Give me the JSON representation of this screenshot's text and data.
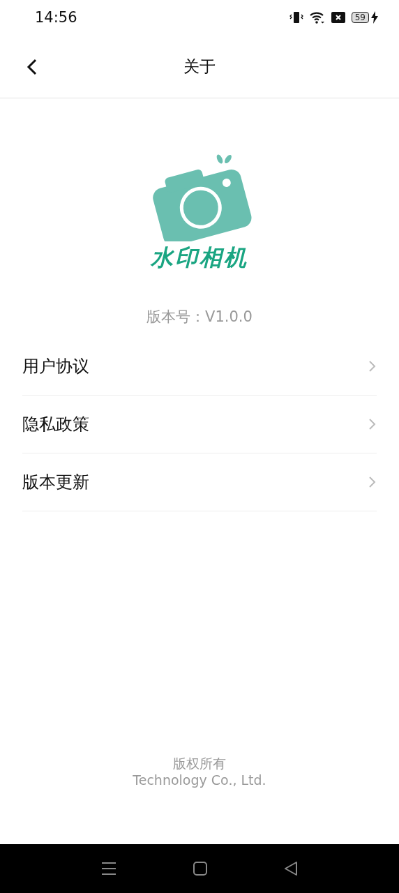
{
  "status_bar": {
    "time": "14:56",
    "battery": "59"
  },
  "header": {
    "title": "关于"
  },
  "app": {
    "name": "水印相机",
    "version": "版本号：V1.0.0"
  },
  "menu": [
    {
      "label": "用户协议"
    },
    {
      "label": "隐私政策"
    },
    {
      "label": "版本更新"
    }
  ],
  "footer": {
    "line_1": "版权所有",
    "line_2": "Technology Co., Ltd."
  }
}
